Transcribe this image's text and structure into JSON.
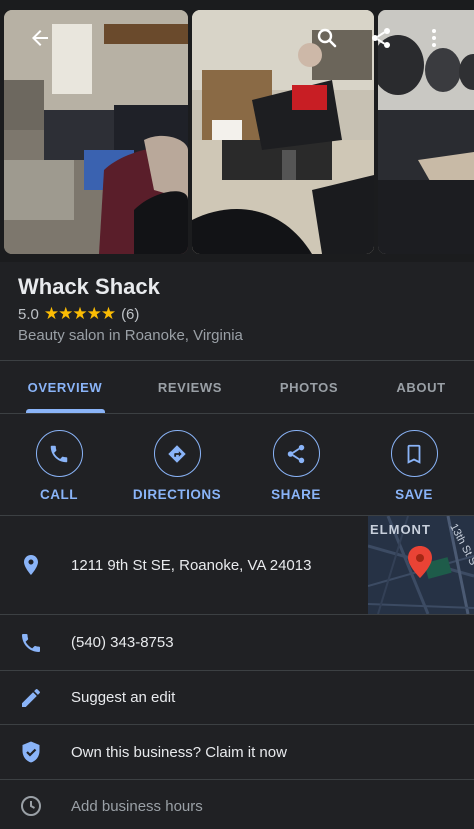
{
  "place": {
    "name": "Whack Shack",
    "rating": "5.0",
    "stars": "★★★★★",
    "review_count": "(6)",
    "category": "Beauty salon in Roanoke, Virginia"
  },
  "tabs": [
    {
      "label": "OVERVIEW",
      "active": true
    },
    {
      "label": "REVIEWS",
      "active": false
    },
    {
      "label": "PHOTOS",
      "active": false
    },
    {
      "label": "ABOUT",
      "active": false
    }
  ],
  "actions": [
    {
      "label": "CALL",
      "icon": "phone-icon"
    },
    {
      "label": "DIRECTIONS",
      "icon": "directions-icon"
    },
    {
      "label": "SHARE",
      "icon": "share-icon"
    },
    {
      "label": "SAVE",
      "icon": "bookmark-icon"
    }
  ],
  "details": {
    "address": "1211 9th St SE, Roanoke, VA 24013",
    "phone": "(540) 343-8753",
    "suggest_edit": "Suggest an edit",
    "claim": "Own this business? Claim it now",
    "hours": "Add business hours"
  },
  "map": {
    "label_neighborhood": "ELMONT",
    "label_street": "13th St S"
  },
  "colors": {
    "background": "#202124",
    "accent": "#8ab4f8",
    "star": "#fbbc04",
    "pin": "#ea4335",
    "divider": "#3c4043"
  }
}
